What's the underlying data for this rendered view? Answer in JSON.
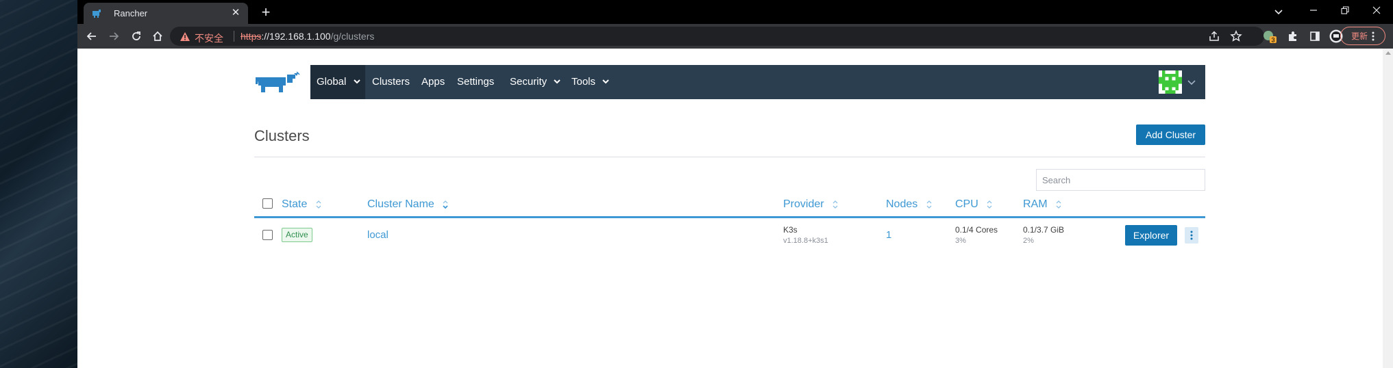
{
  "browser": {
    "tab_title": "Rancher",
    "tab_close": "✕",
    "new_tab": "+",
    "security_label": "不安全",
    "url_scheme": "https",
    "url_host": "://192.168.1.100",
    "url_path": "/g/clusters",
    "update_label": "更新",
    "extension_badge": "3"
  },
  "nav": {
    "items": [
      "Global",
      "Clusters",
      "Apps",
      "Settings",
      "Security",
      "Tools"
    ]
  },
  "page": {
    "title": "Clusters",
    "add_button": "Add Cluster",
    "search_placeholder": "Search"
  },
  "table": {
    "columns": [
      "State",
      "Cluster Name",
      "Provider",
      "Nodes",
      "CPU",
      "RAM"
    ],
    "rows": [
      {
        "state": "Active",
        "name": "local",
        "provider": "K3s",
        "provider_version": "v1.18.8+k3s1",
        "nodes": "1",
        "cpu": "0.1/4 Cores",
        "cpu_pct": "3%",
        "ram": "0.1/3.7 GiB",
        "ram_pct": "2%",
        "action": "Explorer"
      }
    ]
  },
  "colors": {
    "nav_bg": "#2b3e50",
    "accent": "#3d98d3",
    "button": "#1375b2",
    "active_badge": "#2f8f4e"
  }
}
